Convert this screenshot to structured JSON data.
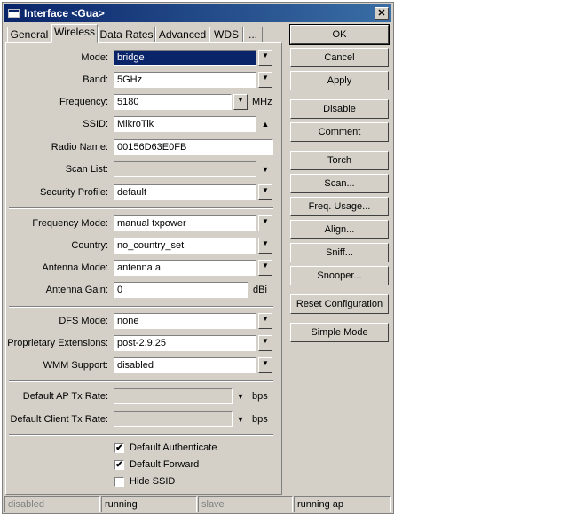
{
  "window": {
    "title": "Interface <Gua>",
    "close_label": "✕"
  },
  "tabs": [
    {
      "label": "General"
    },
    {
      "label": "Wireless"
    },
    {
      "label": "Data Rates"
    },
    {
      "label": "Advanced"
    },
    {
      "label": "WDS"
    },
    {
      "label": "..."
    }
  ],
  "fields": {
    "mode": {
      "label": "Mode:",
      "value": "bridge"
    },
    "band": {
      "label": "Band:",
      "value": "5GHz"
    },
    "frequency": {
      "label": "Frequency:",
      "value": "5180",
      "unit": "MHz"
    },
    "ssid": {
      "label": "SSID:",
      "value": "MikroTik"
    },
    "radio_name": {
      "label": "Radio Name:",
      "value": "00156D63E0FB"
    },
    "scan_list": {
      "label": "Scan List:",
      "value": ""
    },
    "security_profile": {
      "label": "Security Profile:",
      "value": "default"
    },
    "frequency_mode": {
      "label": "Frequency Mode:",
      "value": "manual txpower"
    },
    "country": {
      "label": "Country:",
      "value": "no_country_set"
    },
    "antenna_mode": {
      "label": "Antenna Mode:",
      "value": "antenna a"
    },
    "antenna_gain": {
      "label": "Antenna Gain:",
      "value": "0",
      "unit": "dBi"
    },
    "dfs_mode": {
      "label": "DFS Mode:",
      "value": "none"
    },
    "proprietary_extensions": {
      "label": "Proprietary Extensions:",
      "value": "post-2.9.25"
    },
    "wmm_support": {
      "label": "WMM Support:",
      "value": "disabled"
    },
    "default_ap_tx_rate": {
      "label": "Default AP Tx Rate:",
      "value": "",
      "unit": "bps"
    },
    "default_client_tx_rate": {
      "label": "Default Client Tx Rate:",
      "value": "",
      "unit": "bps"
    }
  },
  "checkboxes": {
    "default_authenticate": {
      "label": "Default Authenticate",
      "checked": true
    },
    "default_forward": {
      "label": "Default Forward",
      "checked": true
    },
    "hide_ssid": {
      "label": "Hide SSID",
      "checked": false
    }
  },
  "check_mark": "✔",
  "buttons": {
    "ok": "OK",
    "cancel": "Cancel",
    "apply": "Apply",
    "disable": "Disable",
    "comment": "Comment",
    "torch": "Torch",
    "scan": "Scan...",
    "freq_usage": "Freq. Usage...",
    "align": "Align...",
    "sniff": "Sniff...",
    "snooper": "Snooper...",
    "reset_configuration": "Reset Configuration",
    "simple_mode": "Simple Mode"
  },
  "status_bar": [
    "disabled",
    "running",
    "slave",
    "running ap"
  ],
  "icons": {
    "dropdown": "▼",
    "expand_up": "▲",
    "dropdown_small": "▼"
  },
  "colors": {
    "selection": "#0a246a",
    "title_gradient_start": "#0a246a",
    "title_gradient_end": "#3a6ea5",
    "face": "#d4d0c8"
  }
}
